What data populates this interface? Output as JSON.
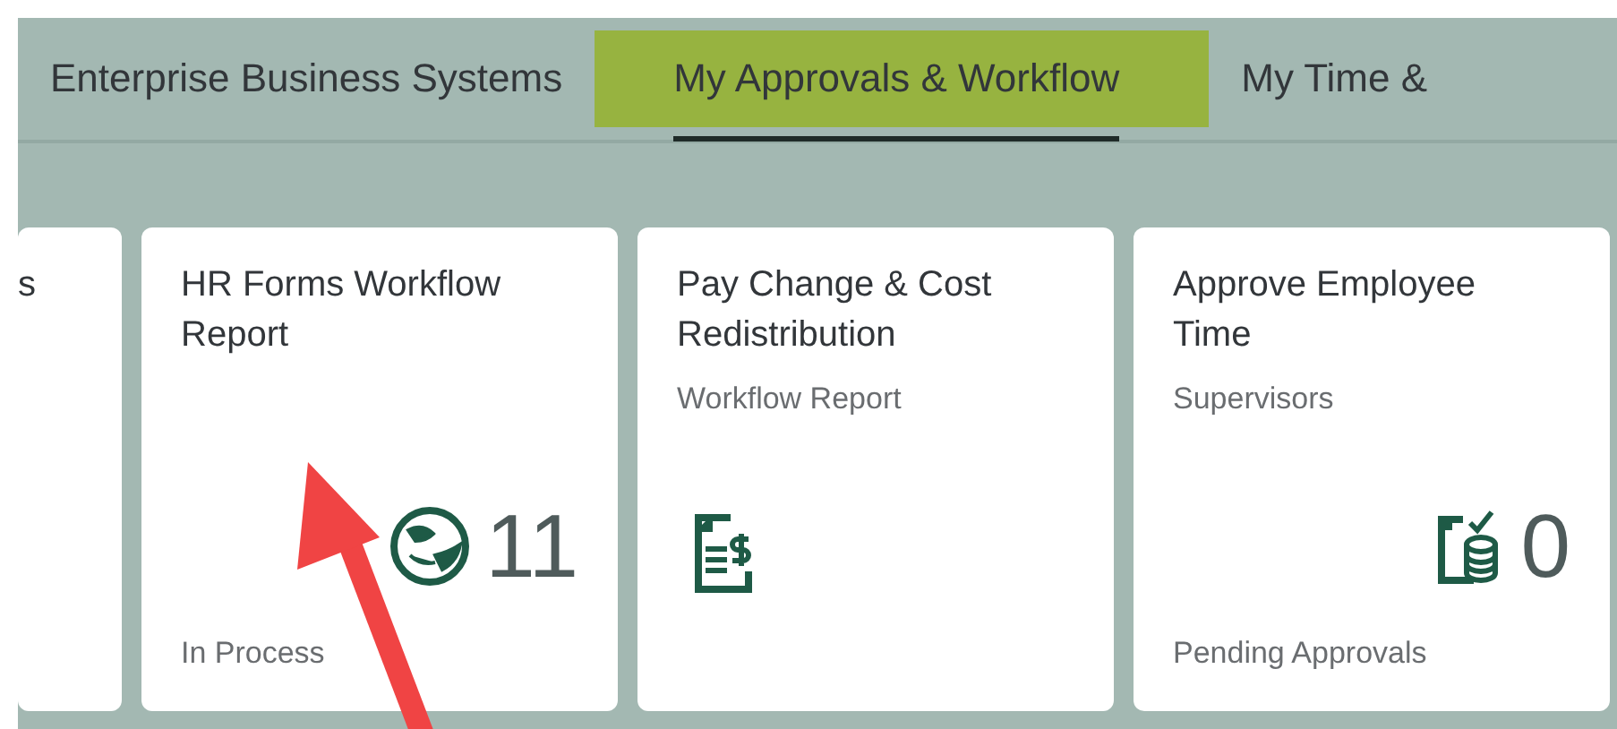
{
  "tabs": [
    {
      "label": "Enterprise Business Systems",
      "selected": false
    },
    {
      "label": "My Approvals & Workflow",
      "selected": true
    },
    {
      "label": "My Time &",
      "selected": false
    }
  ],
  "tiles": [
    {
      "title": "s",
      "kind": "partial"
    },
    {
      "title": "HR Forms Workflow Report",
      "kind": "tile",
      "number": "11",
      "footer": "In Process"
    },
    {
      "title": "Pay Change & Cost Redistribution",
      "kind": "tile",
      "subtitle": "Workflow Report"
    },
    {
      "title": "Approve Employee Time",
      "kind": "tile",
      "subtitle": "Supervisors",
      "number": "0",
      "footer": "Pending Approvals"
    }
  ],
  "annotation": {
    "kind": "arrow"
  }
}
